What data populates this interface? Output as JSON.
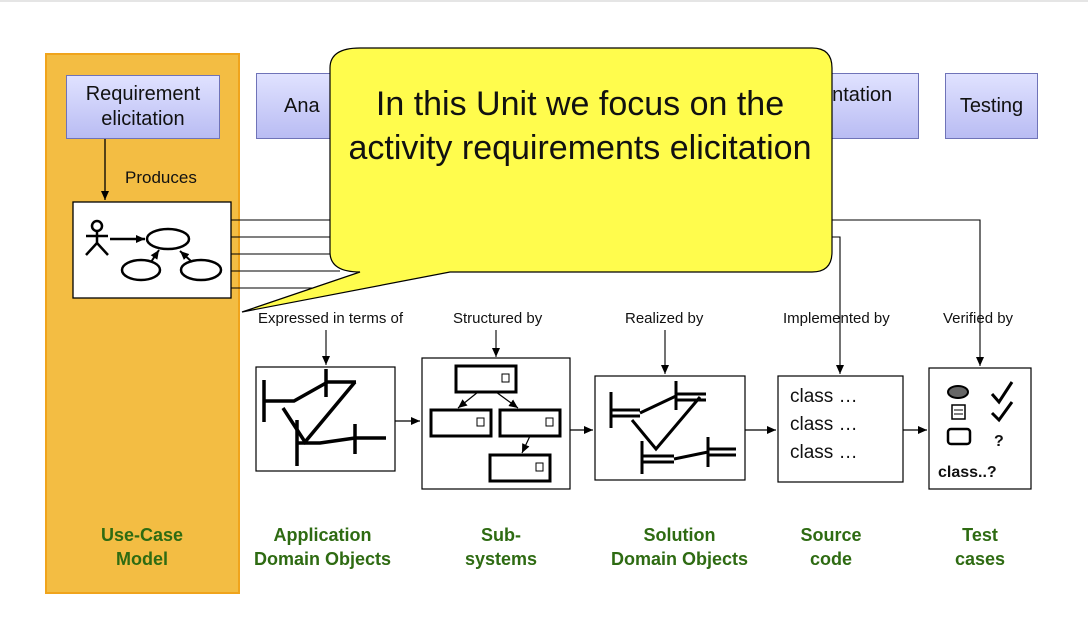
{
  "activities": {
    "requirement_elicitation": "Requirement elicitation",
    "analysis": "Ana",
    "implementation": "entation",
    "testing": "Testing"
  },
  "relations": {
    "produces": "Produces",
    "expressed": "Expressed in terms of",
    "structured": "Structured by",
    "realized": "Realized by",
    "implemented": "Implemented by",
    "verified": "Verified by"
  },
  "models": {
    "use_case": [
      "Use-Case",
      "Model"
    ],
    "app_domain": [
      "Application",
      "Domain Objects"
    ],
    "subsystems": [
      "Sub-",
      "systems"
    ],
    "solution_domain": [
      "Solution",
      "Domain Objects"
    ],
    "source_code": [
      "Source",
      "code"
    ],
    "test_cases": [
      "Test",
      "cases"
    ]
  },
  "source_code_lines": [
    "class …",
    "class …",
    "class …"
  ],
  "test_case_marks": {
    "q1": "?",
    "q2": "class..?"
  },
  "callout": "In this Unit we focus on the activity requirements elicitation",
  "colors": {
    "callout": "#fffc4d",
    "use_case_column": "#f3bd43",
    "model_label": "#2e6b12"
  }
}
